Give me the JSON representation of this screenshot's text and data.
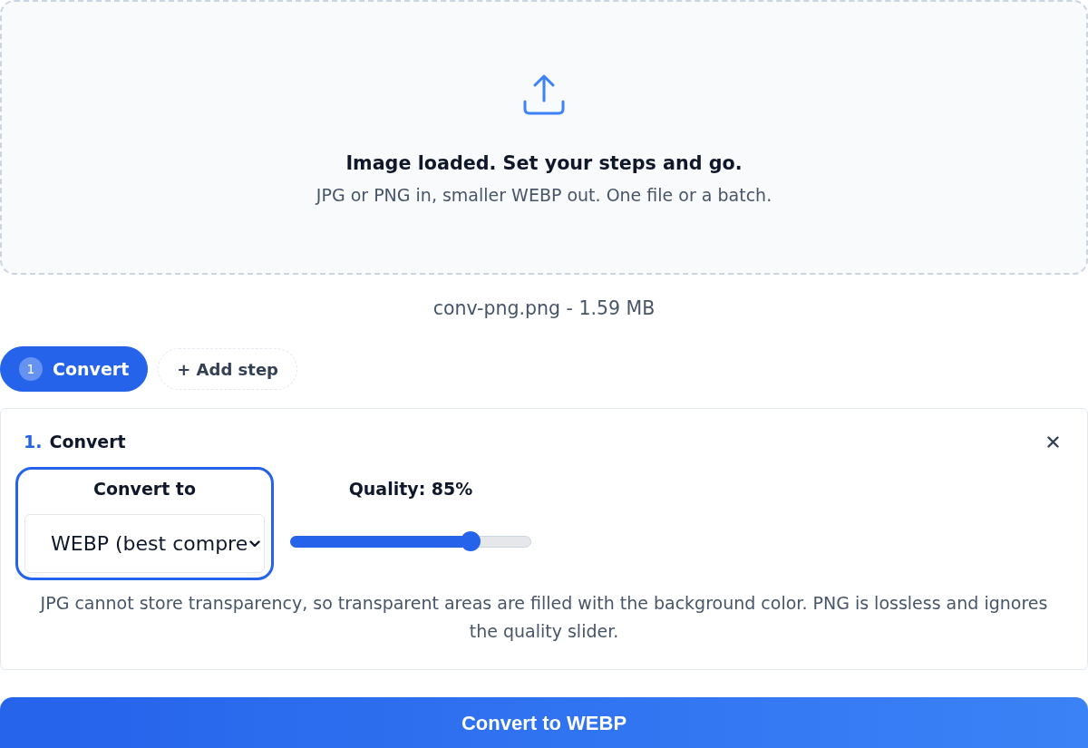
{
  "dropzone": {
    "title": "Image loaded. Set your steps and go.",
    "subtitle": "JPG or PNG in, smaller WEBP out. One file or a batch."
  },
  "file_info": "conv-png.png - 1.59 MB",
  "steps": [
    {
      "number": "1",
      "label": "Convert",
      "selected": true
    }
  ],
  "add_step_button": "+ Add step",
  "step_panel": {
    "number": "1.",
    "title": "Convert",
    "format": {
      "label": "Convert to",
      "value": "WEBP (best compre",
      "focused": true
    },
    "quality": {
      "label": "Quality: 85%",
      "level": 0.75
    },
    "note": "JPG cannot store transparency, so transparent areas are filled with the background color. PNG is lossless and ignores the quality slider."
  },
  "primary_button": "Convert to WEBP"
}
